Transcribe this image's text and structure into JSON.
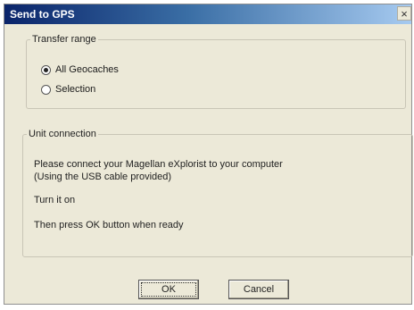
{
  "window": {
    "title": "Send to GPS",
    "close_symbol": "×"
  },
  "transfer_range": {
    "legend": "Transfer range",
    "options": [
      {
        "label": "All Geocaches",
        "checked": true
      },
      {
        "label": "Selection",
        "checked": false
      }
    ]
  },
  "unit_connection": {
    "legend": "Unit connection",
    "lines": [
      "Please connect your Magellan eXplorist to your computer",
      "(Using the USB cable provided)",
      "Turn it on",
      "Then press OK button when ready"
    ]
  },
  "buttons": {
    "ok": "OK",
    "cancel": "Cancel"
  }
}
